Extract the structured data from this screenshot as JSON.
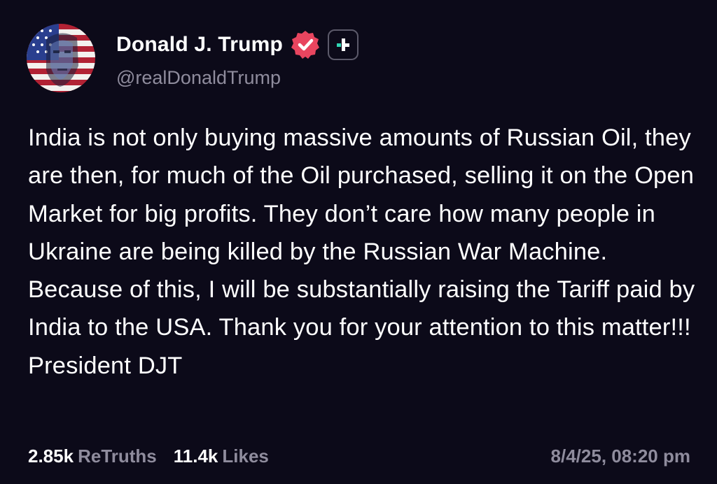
{
  "colors": {
    "background": "#0c0a19",
    "text_primary": "#ffffff",
    "text_secondary": "#8f8c9d",
    "verified_badge": "#e8455f",
    "plus_badge_accent": "#2fd6b4"
  },
  "post": {
    "author": {
      "display_name": "Donald J. Trump",
      "handle": "@realDonaldTrump",
      "avatar_icon": "avatar-flag-portrait",
      "verified_icon": "verified-badge-icon",
      "plus_icon": "plus-badge-icon"
    },
    "text": "India is not only buying massive amounts of Russian Oil, they are then, for much of the Oil purchased, selling it on the Open Market for big profits. They don’t care how many people in Ukraine are being killed by the Russian War Machine. Because of this, I will be substantially raising the Tariff paid by India to the USA. Thank you for your attention to this matter!!! President DJT",
    "stats": {
      "retruths_count": "2.85k",
      "retruths_label": "ReTruths",
      "likes_count": "11.4k",
      "likes_label": "Likes"
    },
    "timestamp": "8/4/25, 08:20 pm"
  }
}
